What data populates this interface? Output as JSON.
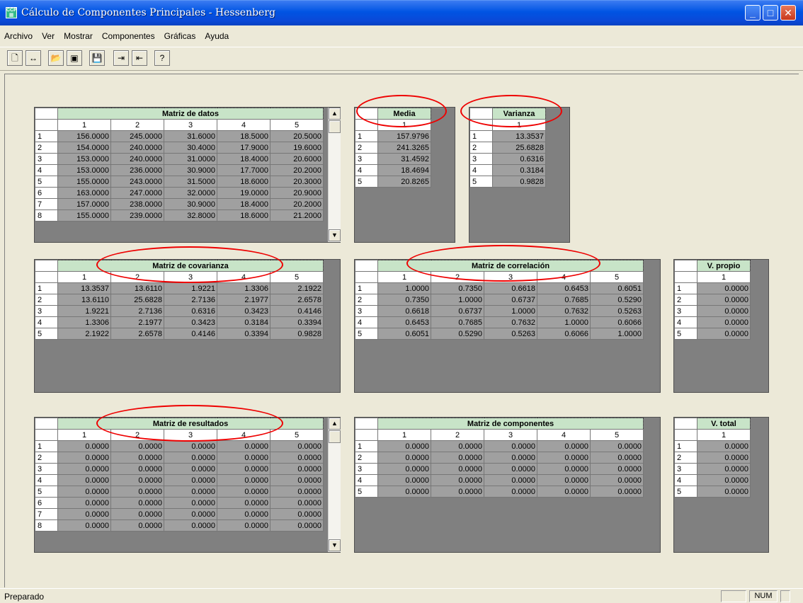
{
  "window": {
    "title": "Cálculo de Componentes Principales - Hessenberg",
    "icon": "app-icon",
    "min": "_",
    "max": "□",
    "close": "✕"
  },
  "menu": [
    "Archivo",
    "Ver",
    "Mostrar",
    "Componentes",
    "Gráficas",
    "Ayuda"
  ],
  "toolbar": [
    {
      "name": "new-icon",
      "glyph": "🗋"
    },
    {
      "name": "resize-icon",
      "glyph": "↔"
    },
    {
      "name": "open-folder-icon",
      "glyph": "📂"
    },
    {
      "name": "window-icon",
      "glyph": "▣"
    },
    {
      "name": "save-icon",
      "glyph": "💾"
    },
    {
      "name": "export-data-icon",
      "glyph": "⇥"
    },
    {
      "name": "import-data-icon",
      "glyph": "⇤"
    },
    {
      "name": "help-icon",
      "glyph": "?"
    }
  ],
  "grids": {
    "datos": {
      "title": "Matriz de datos",
      "cols": [
        "1",
        "2",
        "3",
        "4",
        "5"
      ],
      "rows": [
        [
          "156.0000",
          "245.0000",
          "31.6000",
          "18.5000",
          "20.5000"
        ],
        [
          "154.0000",
          "240.0000",
          "30.4000",
          "17.9000",
          "19.6000"
        ],
        [
          "153.0000",
          "240.0000",
          "31.0000",
          "18.4000",
          "20.6000"
        ],
        [
          "153.0000",
          "236.0000",
          "30.9000",
          "17.7000",
          "20.2000"
        ],
        [
          "155.0000",
          "243.0000",
          "31.5000",
          "18.6000",
          "20.3000"
        ],
        [
          "163.0000",
          "247.0000",
          "32.0000",
          "19.0000",
          "20.9000"
        ],
        [
          "157.0000",
          "238.0000",
          "30.9000",
          "18.4000",
          "20.2000"
        ],
        [
          "155.0000",
          "239.0000",
          "32.8000",
          "18.6000",
          "21.2000"
        ]
      ]
    },
    "media": {
      "title": "Media",
      "cols": [
        "1"
      ],
      "rows": [
        [
          "157.9796"
        ],
        [
          "241.3265"
        ],
        [
          "31.4592"
        ],
        [
          "18.4694"
        ],
        [
          "20.8265"
        ]
      ]
    },
    "varianza": {
      "title": "Varianza",
      "cols": [
        "1"
      ],
      "rows": [
        [
          "13.3537"
        ],
        [
          "25.6828"
        ],
        [
          "0.6316"
        ],
        [
          "0.3184"
        ],
        [
          "0.9828"
        ]
      ]
    },
    "covarianza": {
      "title": "Matriz de covarianza",
      "cols": [
        "1",
        "2",
        "3",
        "4",
        "5"
      ],
      "rows": [
        [
          "13.3537",
          "13.6110",
          "1.9221",
          "1.3306",
          "2.1922"
        ],
        [
          "13.6110",
          "25.6828",
          "2.7136",
          "2.1977",
          "2.6578"
        ],
        [
          "1.9221",
          "2.7136",
          "0.6316",
          "0.3423",
          "0.4146"
        ],
        [
          "1.3306",
          "2.1977",
          "0.3423",
          "0.3184",
          "0.3394"
        ],
        [
          "2.1922",
          "2.6578",
          "0.4146",
          "0.3394",
          "0.9828"
        ]
      ]
    },
    "correlacion": {
      "title": "Matriz de correlación",
      "cols": [
        "1",
        "2",
        "3",
        "4",
        "5"
      ],
      "rows": [
        [
          "1.0000",
          "0.7350",
          "0.6618",
          "0.6453",
          "0.6051"
        ],
        [
          "0.7350",
          "1.0000",
          "0.6737",
          "0.7685",
          "0.5290"
        ],
        [
          "0.6618",
          "0.6737",
          "1.0000",
          "0.7632",
          "0.5263"
        ],
        [
          "0.6453",
          "0.7685",
          "0.7632",
          "1.0000",
          "0.6066"
        ],
        [
          "0.6051",
          "0.5290",
          "0.5263",
          "0.6066",
          "1.0000"
        ]
      ]
    },
    "vpropio": {
      "title": "V. propio",
      "cols": [
        "1"
      ],
      "rows": [
        [
          "0.0000"
        ],
        [
          "0.0000"
        ],
        [
          "0.0000"
        ],
        [
          "0.0000"
        ],
        [
          "0.0000"
        ]
      ]
    },
    "resultados": {
      "title": "Matriz de resultados",
      "cols": [
        "1",
        "2",
        "3",
        "4",
        "5"
      ],
      "rows": [
        [
          "0.0000",
          "0.0000",
          "0.0000",
          "0.0000",
          "0.0000"
        ],
        [
          "0.0000",
          "0.0000",
          "0.0000",
          "0.0000",
          "0.0000"
        ],
        [
          "0.0000",
          "0.0000",
          "0.0000",
          "0.0000",
          "0.0000"
        ],
        [
          "0.0000",
          "0.0000",
          "0.0000",
          "0.0000",
          "0.0000"
        ],
        [
          "0.0000",
          "0.0000",
          "0.0000",
          "0.0000",
          "0.0000"
        ],
        [
          "0.0000",
          "0.0000",
          "0.0000",
          "0.0000",
          "0.0000"
        ],
        [
          "0.0000",
          "0.0000",
          "0.0000",
          "0.0000",
          "0.0000"
        ],
        [
          "0.0000",
          "0.0000",
          "0.0000",
          "0.0000",
          "0.0000"
        ]
      ]
    },
    "componentes": {
      "title": "Matriz de componentes",
      "cols": [
        "1",
        "2",
        "3",
        "4",
        "5"
      ],
      "rows": [
        [
          "0.0000",
          "0.0000",
          "0.0000",
          "0.0000",
          "0.0000"
        ],
        [
          "0.0000",
          "0.0000",
          "0.0000",
          "0.0000",
          "0.0000"
        ],
        [
          "0.0000",
          "0.0000",
          "0.0000",
          "0.0000",
          "0.0000"
        ],
        [
          "0.0000",
          "0.0000",
          "0.0000",
          "0.0000",
          "0.0000"
        ],
        [
          "0.0000",
          "0.0000",
          "0.0000",
          "0.0000",
          "0.0000"
        ]
      ]
    },
    "vtotal": {
      "title": "V. total",
      "cols": [
        "1"
      ],
      "rows": [
        [
          "0.0000"
        ],
        [
          "0.0000"
        ],
        [
          "0.0000"
        ],
        [
          "0.0000"
        ],
        [
          "0.0000"
        ]
      ]
    }
  },
  "status": {
    "message": "Preparado",
    "num": "NUM"
  },
  "colors": {
    "title_header": "#c8e4c8",
    "cell": "#a0a0a0",
    "annotation": "#e00000"
  }
}
